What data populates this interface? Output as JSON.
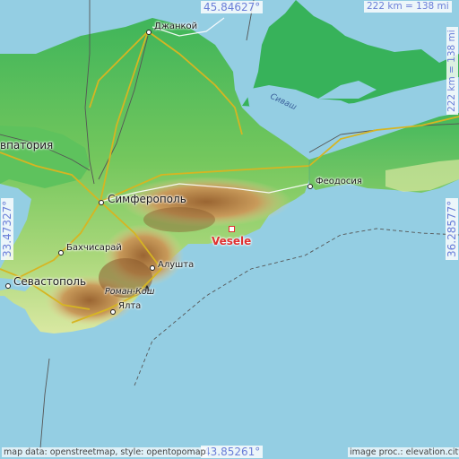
{
  "coordinates": {
    "top_lat": "45.84627°",
    "bottom_lat": "43.85261°",
    "left_lon": "33.47327°",
    "right_lon": "36.28577°"
  },
  "scale": {
    "horizontal": "222 km = 138 mi",
    "vertical": "222 km = 138 mi"
  },
  "marker": {
    "label": "Vesele"
  },
  "places": {
    "dzhankoy": "Джанкой",
    "yevpatoria": "впатория",
    "simferopol": "Симферополь",
    "feodosia": "Феодосия",
    "bakhchisaray": "Бахчисарай",
    "alushta": "Алушта",
    "sevastopol": "Севастополь",
    "roman_kosh": "Роман-Кош",
    "yalta": "Ялта",
    "sivash": "Сиваш"
  },
  "attribution": {
    "left": "map data: openstreetmap, style: opentopomap",
    "right": "image proc.: elevation.city"
  },
  "colors": {
    "sea": "#94cee3",
    "lowland": "#5cc35f",
    "plain": "#c8e08a",
    "mountain": "#a8703a",
    "marker": "#e03030",
    "coord_text": "#6a7ed8"
  }
}
